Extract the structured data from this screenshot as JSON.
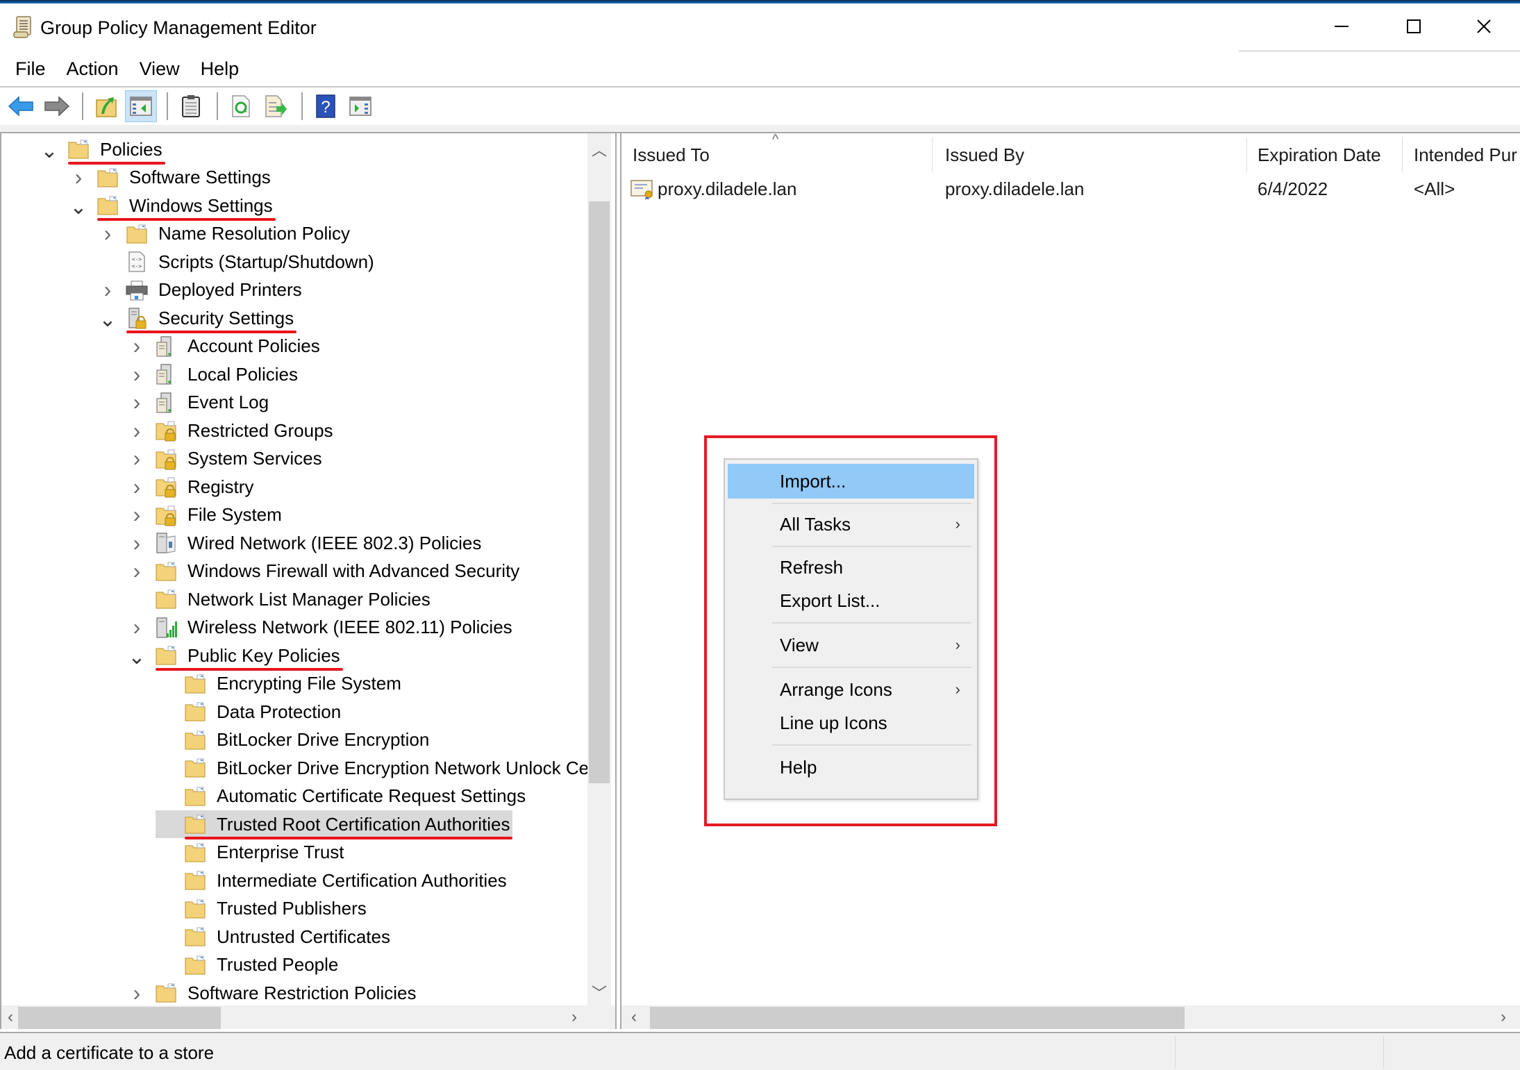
{
  "window": {
    "title": "Group Policy Management Editor",
    "controls": {
      "minimize": "—",
      "maximize": "☐",
      "close": "✕"
    }
  },
  "menubar": {
    "items": [
      "File",
      "Action",
      "View",
      "Help"
    ]
  },
  "toolbar": {
    "buttons": [
      {
        "name": "back-icon",
        "active": false
      },
      {
        "name": "forward-icon",
        "active": false
      },
      {
        "name": "up-folder-icon",
        "active": false
      },
      {
        "name": "show-hide-console-tree-icon",
        "active": true
      },
      {
        "name": "clipboard-icon",
        "active": false
      },
      {
        "name": "refresh-icon",
        "active": false
      },
      {
        "name": "export-list-icon",
        "active": false
      },
      {
        "name": "help-icon",
        "active": false
      },
      {
        "name": "show-hide-action-pane-icon",
        "active": false
      }
    ]
  },
  "tree": {
    "items": [
      {
        "label": "Policies",
        "level": 0,
        "expander": "open",
        "icon": "folder",
        "underlined": true
      },
      {
        "label": "Software Settings",
        "level": 1,
        "expander": "closed",
        "icon": "folder"
      },
      {
        "label": "Windows Settings",
        "level": 1,
        "expander": "open",
        "icon": "folder",
        "underlined": true
      },
      {
        "label": "Name Resolution Policy",
        "level": 2,
        "expander": "closed",
        "icon": "folder"
      },
      {
        "label": "Scripts (Startup/Shutdown)",
        "level": 2,
        "expander": "none",
        "icon": "script"
      },
      {
        "label": "Deployed Printers",
        "level": 2,
        "expander": "closed",
        "icon": "printer"
      },
      {
        "label": "Security Settings",
        "level": 2,
        "expander": "open",
        "icon": "security",
        "underlined": true
      },
      {
        "label": "Account Policies",
        "level": 3,
        "expander": "closed",
        "icon": "server"
      },
      {
        "label": "Local Policies",
        "level": 3,
        "expander": "closed",
        "icon": "server"
      },
      {
        "label": "Event Log",
        "level": 3,
        "expander": "closed",
        "icon": "server"
      },
      {
        "label": "Restricted Groups",
        "level": 3,
        "expander": "closed",
        "icon": "locked-folder"
      },
      {
        "label": "System Services",
        "level": 3,
        "expander": "closed",
        "icon": "locked-folder"
      },
      {
        "label": "Registry",
        "level": 3,
        "expander": "closed",
        "icon": "locked-folder"
      },
      {
        "label": "File System",
        "level": 3,
        "expander": "closed",
        "icon": "locked-folder"
      },
      {
        "label": "Wired Network (IEEE 802.3) Policies",
        "level": 3,
        "expander": "closed",
        "icon": "wired-network"
      },
      {
        "label": "Windows Firewall with Advanced Security",
        "level": 3,
        "expander": "closed",
        "icon": "folder"
      },
      {
        "label": "Network List Manager Policies",
        "level": 3,
        "expander": "none",
        "icon": "folder"
      },
      {
        "label": "Wireless Network (IEEE 802.11) Policies",
        "level": 3,
        "expander": "closed",
        "icon": "wireless-network"
      },
      {
        "label": "Public Key Policies",
        "level": 3,
        "expander": "open",
        "icon": "folder",
        "underlined": true
      },
      {
        "label": "Encrypting File System",
        "level": 4,
        "expander": "none",
        "icon": "folder"
      },
      {
        "label": "Data Protection",
        "level": 4,
        "expander": "none",
        "icon": "folder"
      },
      {
        "label": "BitLocker Drive Encryption",
        "level": 4,
        "expander": "none",
        "icon": "folder"
      },
      {
        "label": "BitLocker Drive Encryption Network Unlock Certificate",
        "level": 4,
        "expander": "none",
        "icon": "folder"
      },
      {
        "label": "Automatic Certificate Request Settings",
        "level": 4,
        "expander": "none",
        "icon": "folder"
      },
      {
        "label": "Trusted Root Certification Authorities",
        "level": 4,
        "expander": "none",
        "icon": "folder",
        "selected": true,
        "underlined": true
      },
      {
        "label": "Enterprise Trust",
        "level": 4,
        "expander": "none",
        "icon": "folder"
      },
      {
        "label": "Intermediate Certification Authorities",
        "level": 4,
        "expander": "none",
        "icon": "folder"
      },
      {
        "label": "Trusted Publishers",
        "level": 4,
        "expander": "none",
        "icon": "folder"
      },
      {
        "label": "Untrusted Certificates",
        "level": 4,
        "expander": "none",
        "icon": "folder"
      },
      {
        "label": "Trusted People",
        "level": 4,
        "expander": "none",
        "icon": "folder"
      },
      {
        "label": "Software Restriction Policies",
        "level": 3,
        "expander": "closed",
        "icon": "folder"
      }
    ]
  },
  "list": {
    "columns": [
      "Issued To",
      "Issued By",
      "Expiration Date",
      "Intended Pur"
    ],
    "sorted_column": "Issued To",
    "rows": [
      {
        "issued_to": "proxy.diladele.lan",
        "issued_by": "proxy.diladele.lan",
        "expiration": "6/4/2022",
        "intended": "<All>"
      }
    ]
  },
  "context_menu": {
    "items": [
      {
        "label": "Import...",
        "submenu": false,
        "highlighted": true
      },
      {
        "label": "All Tasks",
        "submenu": true
      },
      {
        "label": "Refresh",
        "submenu": false
      },
      {
        "label": "Export List...",
        "submenu": false
      },
      {
        "label": "View",
        "submenu": true
      },
      {
        "label": "Arrange Icons",
        "submenu": true
      },
      {
        "label": "Line up Icons",
        "submenu": false
      },
      {
        "label": "Help",
        "submenu": false
      }
    ]
  },
  "status_bar": {
    "text": "Add a certificate to a store"
  },
  "colors": {
    "highlight_menu": "#91c9f7",
    "annotation_red": "#e31b23",
    "selected_tree": "#d9d9d9",
    "folder": "#f3d27a"
  }
}
